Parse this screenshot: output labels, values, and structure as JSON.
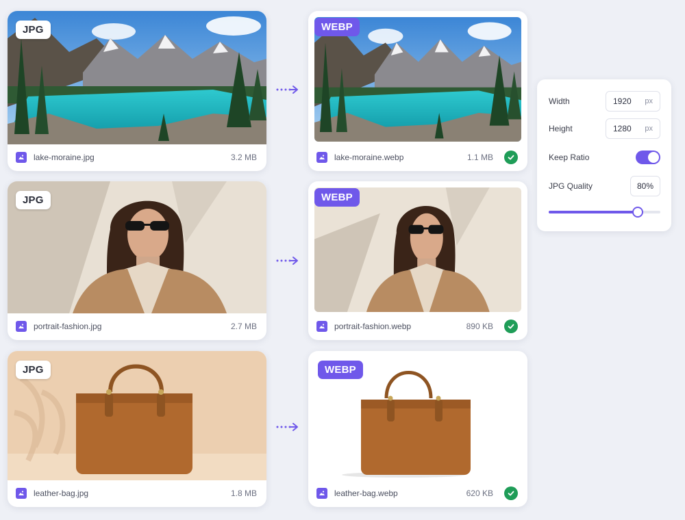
{
  "colors": {
    "accent": "#6f58ea",
    "success": "#1f9d58",
    "background": "#eef0f6"
  },
  "conversions": [
    {
      "source": {
        "badge": "JPG",
        "filename": "lake-moraine.jpg",
        "size": "3.2 MB"
      },
      "target": {
        "badge": "WEBP",
        "filename": "lake-moraine.webp",
        "size": "1.1 MB"
      }
    },
    {
      "source": {
        "badge": "JPG",
        "filename": "portrait-fashion.jpg",
        "size": "2.7 MB"
      },
      "target": {
        "badge": "WEBP",
        "filename": "portrait-fashion.webp",
        "size": "890 KB"
      }
    },
    {
      "source": {
        "badge": "JPG",
        "filename": "leather-bag.jpg",
        "size": "1.8 MB"
      },
      "target": {
        "badge": "WEBP",
        "filename": "leather-bag.webp",
        "size": "620 KB"
      }
    }
  ],
  "icons": {
    "file": "image-file-icon",
    "status": "check-circle-icon",
    "arrow": "dotted-arrow-right-icon"
  },
  "settings": {
    "width_label": "Width",
    "width_value": "1920",
    "width_unit": "px",
    "height_label": "Height",
    "height_value": "1280",
    "height_unit": "px",
    "keep_ratio_label": "Keep Ratio",
    "keep_ratio_on": true,
    "quality_label": "JPG Quality",
    "quality_value": "80%",
    "quality_percent": 80
  }
}
